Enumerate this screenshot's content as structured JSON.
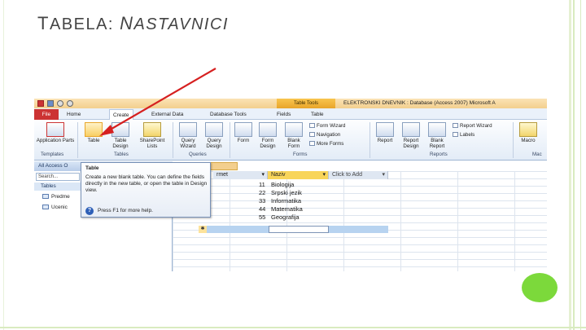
{
  "slide": {
    "title_first": "T",
    "title_rest": "ABELA: ",
    "title_n": "N",
    "title_end": "ASTAVNICI"
  },
  "window": {
    "ribbon_context": "Table Tools",
    "title": "ELEKTRONSKI DNEVNIK : Database (Access 2007)   Microsoft A"
  },
  "tabs": [
    "File",
    "Home",
    "Create",
    "External Data",
    "Database Tools",
    "Fields",
    "Table"
  ],
  "ribbon": {
    "groups": {
      "templates": "Templates",
      "tables": "Tables",
      "queries": "Queries",
      "forms": "Forms",
      "reports": "Reports",
      "macros": "Mac"
    },
    "buttons": {
      "application_parts": "Application Parts",
      "table": "Table",
      "table_design": "Table Design",
      "sharepoint_lists": "SharePoint Lists",
      "query_wizard": "Query Wizard",
      "query_design": "Query Design",
      "form": "Form",
      "form_design": "Form Design",
      "blank_form": "Blank Form",
      "form_wizard": "Form Wizard",
      "navigation": "Navigation",
      "more_forms": "More Forms",
      "report": "Report",
      "report_design": "Report Design",
      "blank_report": "Blank Report",
      "report_wizard": "Report Wizard",
      "labels": "Labels",
      "macro": "Macro"
    }
  },
  "nav": {
    "header": "All Access O",
    "search_placeholder": "Search...",
    "group": "Tables",
    "items": [
      "Predme",
      "Ucenic"
    ]
  },
  "document": {
    "tab_label": "e",
    "columns": [
      "rmet",
      "Naziv",
      "Click to Add"
    ],
    "rows": [
      {
        "id": "11",
        "naziv": "Biologija"
      },
      {
        "id": "22",
        "naziv": "Srpski jezik"
      },
      {
        "id": "33",
        "naziv": "Informatika"
      },
      {
        "id": "44",
        "naziv": "Matematika"
      },
      {
        "id": "55",
        "naziv": "Geografija"
      }
    ]
  },
  "tooltip": {
    "title": "Table",
    "body": "Create a new blank table. You can define the fields directly in the new table, or open the table in Design view.",
    "help": "Press F1 for more help."
  },
  "colors": {
    "arrow": "#d62020",
    "accent": "#7cd93b",
    "file_tab": "#cc3333",
    "context_tab": "#f3b43c"
  }
}
